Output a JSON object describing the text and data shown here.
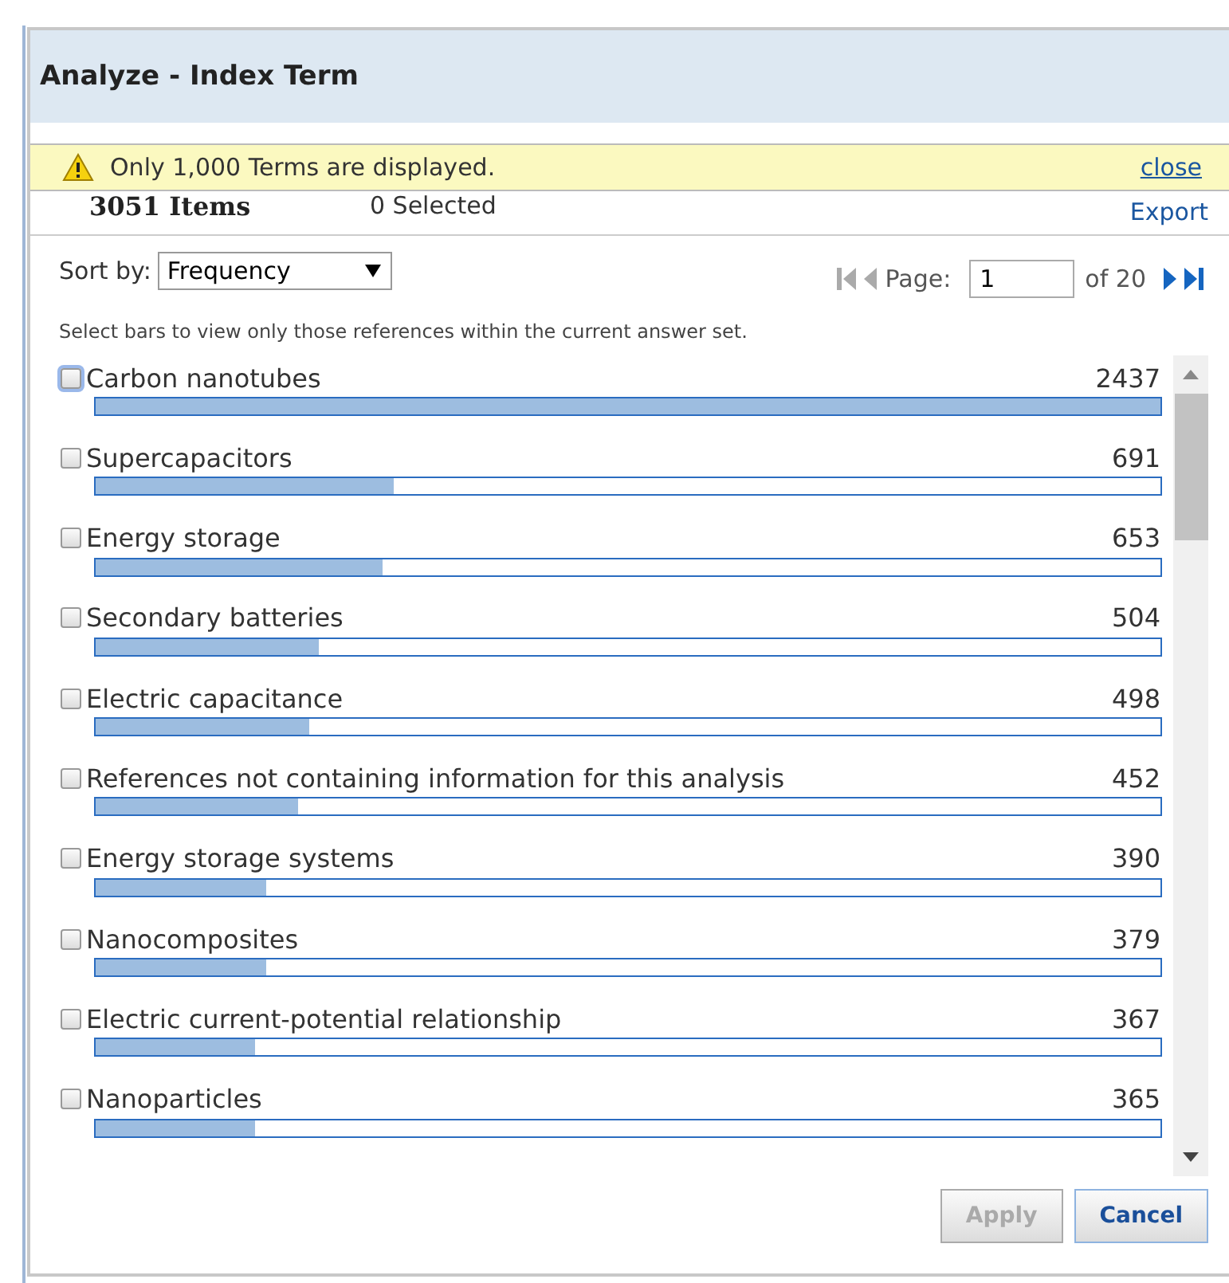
{
  "dialog": {
    "title": "Analyze - Index Term"
  },
  "notice": {
    "text": "Only 1,000 Terms are displayed.",
    "close": "close"
  },
  "summary": {
    "items": "3051 Items",
    "selected": "0 Selected",
    "export": "Export"
  },
  "sort": {
    "label": "Sort by:",
    "value": "Frequency"
  },
  "pager": {
    "label": "Page:",
    "page": "1",
    "of": "of 20"
  },
  "hint": "Select bars to view only those references within the current answer set.",
  "terms": [
    {
      "label": "Carbon nanotubes",
      "count": "2437",
      "level": 1.0,
      "checked": false,
      "focused": true
    },
    {
      "label": "Supercapacitors",
      "count": "691",
      "level": 0.28,
      "checked": false,
      "focused": false
    },
    {
      "label": "Energy storage",
      "count": "653",
      "level": 0.27,
      "checked": false,
      "focused": false
    },
    {
      "label": "Secondary batteries",
      "count": "504",
      "level": 0.21,
      "checked": false,
      "focused": false
    },
    {
      "label": "Electric capacitance",
      "count": "498",
      "level": 0.2,
      "checked": false,
      "focused": false
    },
    {
      "label": "References not containing information for this analysis",
      "count": "452",
      "level": 0.19,
      "checked": false,
      "focused": false
    },
    {
      "label": "Energy storage systems",
      "count": "390",
      "level": 0.16,
      "checked": false,
      "focused": false
    },
    {
      "label": "Nanocomposites",
      "count": "379",
      "level": 0.16,
      "checked": false,
      "focused": false
    },
    {
      "label": "Electric current-potential relationship",
      "count": "367",
      "level": 0.15,
      "checked": false,
      "focused": false
    },
    {
      "label": "Nanoparticles",
      "count": "365",
      "level": 0.15,
      "checked": false,
      "focused": false
    }
  ],
  "buttons": [
    {
      "label": "Apply",
      "disabled": true
    },
    {
      "label": "Cancel",
      "disabled": false
    }
  ]
}
